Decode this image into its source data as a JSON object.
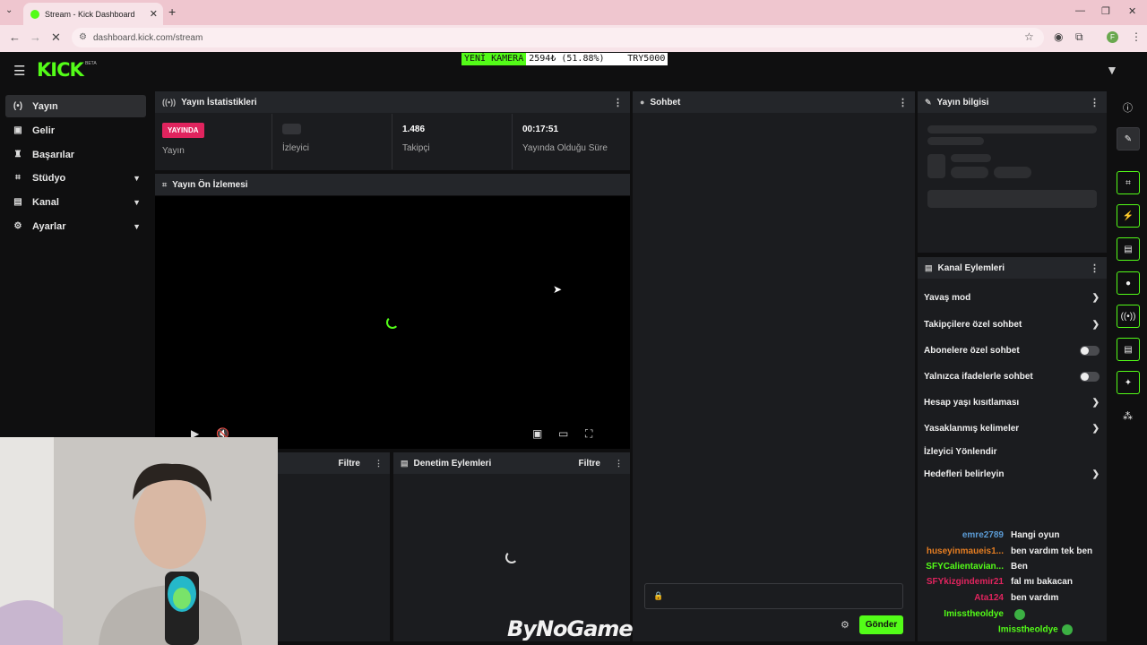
{
  "browser": {
    "tab_title": "Stream - Kick Dashboard",
    "url": "dashboard.kick.com/stream",
    "profile_initial": "F"
  },
  "header": {
    "logo": "KICK",
    "beta": "BETA",
    "ticker_label": "YENİ KAMERA",
    "ticker_value": "2594₺ (51.88%)",
    "ticker_goal": "TRY5000"
  },
  "sidebar": {
    "items": [
      {
        "label": "Yayın",
        "icon": "broadcast-icon"
      },
      {
        "label": "Gelir",
        "icon": "money-icon"
      },
      {
        "label": "Başarılar",
        "icon": "trophy-icon"
      },
      {
        "label": "Stüdyo",
        "icon": "studio-icon"
      },
      {
        "label": "Kanal",
        "icon": "channel-icon"
      },
      {
        "label": "Ayarlar",
        "icon": "gear-icon"
      }
    ]
  },
  "stats": {
    "title": "Yayın İstatistikleri",
    "live_badge": "YAYINDA",
    "stream_label": "Yayın",
    "viewers_label": "İzleyici",
    "followers_value": "1.486",
    "followers_label": "Takipçi",
    "uptime_value": "00:17:51",
    "uptime_label": "Yayında Olduğu Süre"
  },
  "preview": {
    "title": "Yayın Ön İzlemesi"
  },
  "lower_panels": {
    "filter_label": "Filtre",
    "mod_actions_title": "Denetim Eylemleri"
  },
  "chat": {
    "title": "Sohbet",
    "send_label": "Gönder",
    "lines": [
      {
        "user": "emre2789",
        "msg": "Hangi oyun",
        "color": "#5b9bd5"
      },
      {
        "user": "huseyinmaueis1...",
        "msg": "ben vardım tek ben",
        "color": "#e67e22"
      },
      {
        "user": "SFYCalientavian...",
        "msg": "Ben",
        "color": "#53fc18"
      },
      {
        "user": "SFYkizgindemir21",
        "msg": "fal mı bakacan",
        "color": "#e0245e"
      },
      {
        "user": "Ata124",
        "msg": "ben vardım",
        "color": "#e0245e"
      },
      {
        "user": "Imisstheoldye",
        "msg": "",
        "color": "#53fc18"
      },
      {
        "user": "Imisstheoldye",
        "msg": "",
        "color": "#53fc18"
      }
    ]
  },
  "stream_info": {
    "title": "Yayın bilgisi"
  },
  "channel_actions": {
    "title": "Kanal Eylemleri",
    "items": [
      {
        "label": "Yavaş mod",
        "control": "chevron"
      },
      {
        "label": "Takipçilere özel sohbet",
        "control": "chevron"
      },
      {
        "label": "Abonelere özel sohbet",
        "control": "toggle"
      },
      {
        "label": "Yalnızca ifadelerle sohbet",
        "control": "toggle"
      },
      {
        "label": "Hesap yaşı kısıtlaması",
        "control": "chevron"
      },
      {
        "label": "Yasaklanmış kelimeler",
        "control": "chevron"
      },
      {
        "label": "İzleyici Yönlendir",
        "control": "none"
      },
      {
        "label": "Hedefleri belirleyin",
        "control": "chevron"
      }
    ]
  },
  "watermark": "ByNoGame",
  "colors": {
    "accent": "#53fc18",
    "live": "#e0245e",
    "panel": "#1b1c1f"
  }
}
